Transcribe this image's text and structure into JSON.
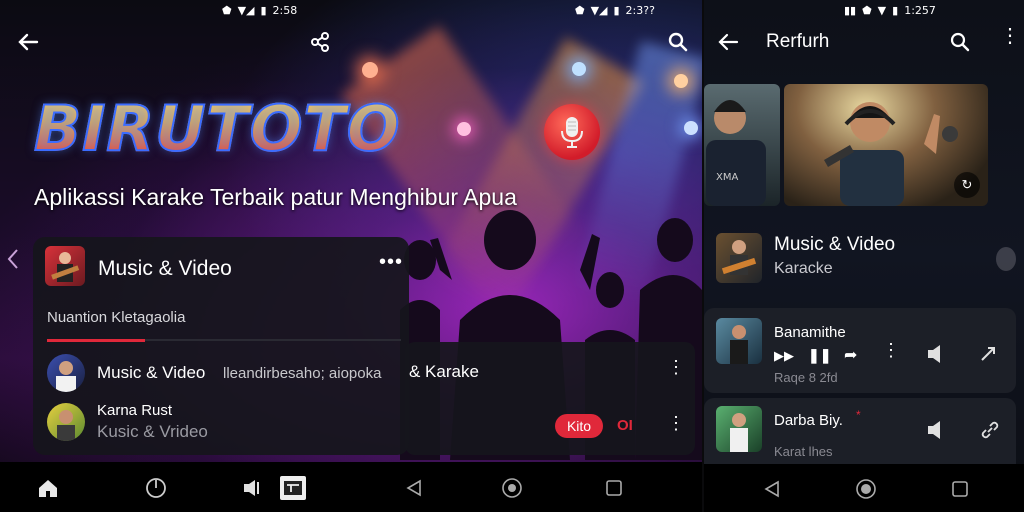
{
  "left": {
    "status": {
      "time": "2:58",
      "battery": "⊡",
      "signal": "▼◢"
    },
    "brand": "BIRUTOTO",
    "tagline": "Aplikassi Karake Terbaik  patur Menghibur Apua",
    "card": {
      "title": "Music & Video",
      "subtitle": "Nuantion Kletagaolia",
      "rows": [
        {
          "title": "Music & Video",
          "extra": "lleandirbesaho; aiopoka"
        },
        {
          "title": "Karna Rust",
          "subtitle": "Kusic & Vrideo"
        }
      ]
    },
    "bottom_card": {
      "title": "& Karake",
      "pill": "Kito",
      "toggle": "OI"
    }
  },
  "right": {
    "status": {
      "time": "1:257"
    },
    "title": "Rerfurh",
    "feature": {
      "title": "Music & Video",
      "subtitle": "Karacke"
    },
    "items": [
      {
        "title": "Banamithe",
        "subtitle": "Raqe 8 2fd"
      },
      {
        "title": "Darba Biy.",
        "subtitle": "Karat lhes"
      }
    ]
  },
  "colors": {
    "accent_red": "#e0283a",
    "card_bg": "#1c1f27"
  }
}
